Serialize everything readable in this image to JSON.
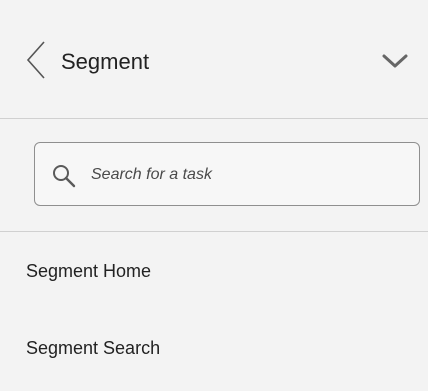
{
  "header": {
    "title": "Segment",
    "back_icon": "chevron-left-icon",
    "expand_icon": "chevron-down-icon"
  },
  "search": {
    "placeholder": "Search for a task",
    "value": "",
    "icon": "search-icon"
  },
  "nav": {
    "items": [
      {
        "label": "Segment Home"
      },
      {
        "label": "Segment Search"
      }
    ]
  }
}
